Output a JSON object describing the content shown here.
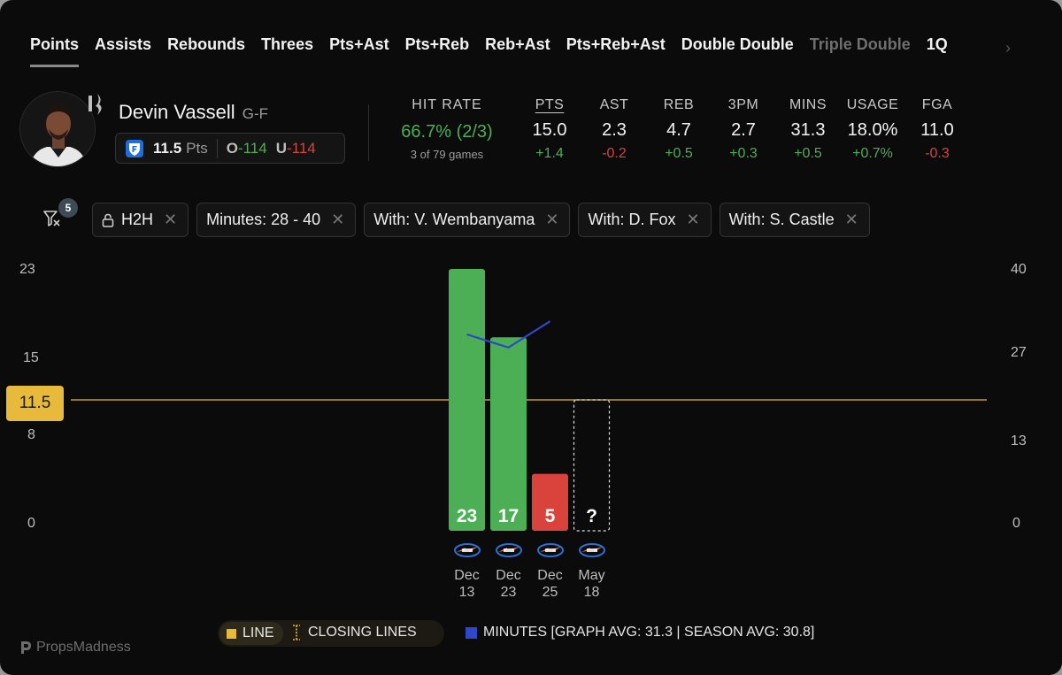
{
  "tabs": [
    {
      "label": "Points",
      "active": true,
      "dim": false
    },
    {
      "label": "Assists",
      "active": false,
      "dim": false
    },
    {
      "label": "Rebounds",
      "active": false,
      "dim": false
    },
    {
      "label": "Threes",
      "active": false,
      "dim": false
    },
    {
      "label": "Pts+Ast",
      "active": false,
      "dim": false
    },
    {
      "label": "Pts+Reb",
      "active": false,
      "dim": false
    },
    {
      "label": "Reb+Ast",
      "active": false,
      "dim": false
    },
    {
      "label": "Pts+Reb+Ast",
      "active": false,
      "dim": false
    },
    {
      "label": "Double Double",
      "active": false,
      "dim": false
    },
    {
      "label": "Triple Double",
      "active": false,
      "dim": true
    },
    {
      "label": "1Q",
      "active": false,
      "dim": false
    }
  ],
  "player": {
    "name": "Devin Vassell",
    "position": "G-F",
    "prop_line": "11.5",
    "prop_unit": "Pts",
    "over_label": "O",
    "over_odds": "-114",
    "under_label": "U",
    "under_odds": "-114"
  },
  "hit_rate": {
    "title": "HIT RATE",
    "value": "66.7% (2/3)",
    "sub": "3 of 79 games"
  },
  "stats": [
    {
      "label": "PTS",
      "value": "15.0",
      "delta": "+1.4",
      "positive": true,
      "selected": true
    },
    {
      "label": "AST",
      "value": "2.3",
      "delta": "-0.2",
      "positive": false,
      "selected": false
    },
    {
      "label": "REB",
      "value": "4.7",
      "delta": "+0.5",
      "positive": true,
      "selected": false
    },
    {
      "label": "3PM",
      "value": "2.7",
      "delta": "+0.3",
      "positive": true,
      "selected": false
    },
    {
      "label": "MINS",
      "value": "31.3",
      "delta": "+0.5",
      "positive": true,
      "selected": false
    },
    {
      "label": "USAGE",
      "value": "18.0%",
      "delta": "+0.7%",
      "positive": true,
      "selected": false
    },
    {
      "label": "FGA",
      "value": "11.0",
      "delta": "-0.3",
      "positive": false,
      "selected": false
    }
  ],
  "filters": {
    "count": "5",
    "chips": [
      "H2H",
      "Minutes: 28 - 40",
      "With: V. Wembanyama",
      "With: D. Fox",
      "With: S. Castle"
    ]
  },
  "line_badge": "11.5",
  "chart_data": {
    "type": "bar",
    "categories": [
      {
        "month": "Dec",
        "day": "13"
      },
      {
        "month": "Dec",
        "day": "23"
      },
      {
        "month": "Dec",
        "day": "25"
      },
      {
        "month": "May",
        "day": "18"
      }
    ],
    "series": [
      {
        "name": "Points",
        "values": [
          23,
          17,
          5,
          null
        ],
        "labels": [
          "23",
          "17",
          "5",
          "?"
        ]
      },
      {
        "name": "MINUTES",
        "values": [
          30,
          28,
          32,
          null
        ]
      }
    ],
    "line": 11.5,
    "y_left_ticks": [
      0,
      8,
      15,
      23
    ],
    "y_left_lim": [
      0,
      23
    ],
    "y_right_ticks": [
      0,
      13,
      27,
      40
    ],
    "y_right_lim": [
      0,
      40
    ],
    "colors": {
      "over": "#4cae55",
      "under": "#d9433b",
      "minutes": "#2f48c9",
      "line": "#e7ba3b"
    }
  },
  "legend": {
    "line": "LINE",
    "closing": "CLOSING LINES",
    "minutes": "MINUTES [GRAPH AVG: 31.3 | SEASON AVG: 30.8]"
  },
  "brand": "PropsMadness"
}
